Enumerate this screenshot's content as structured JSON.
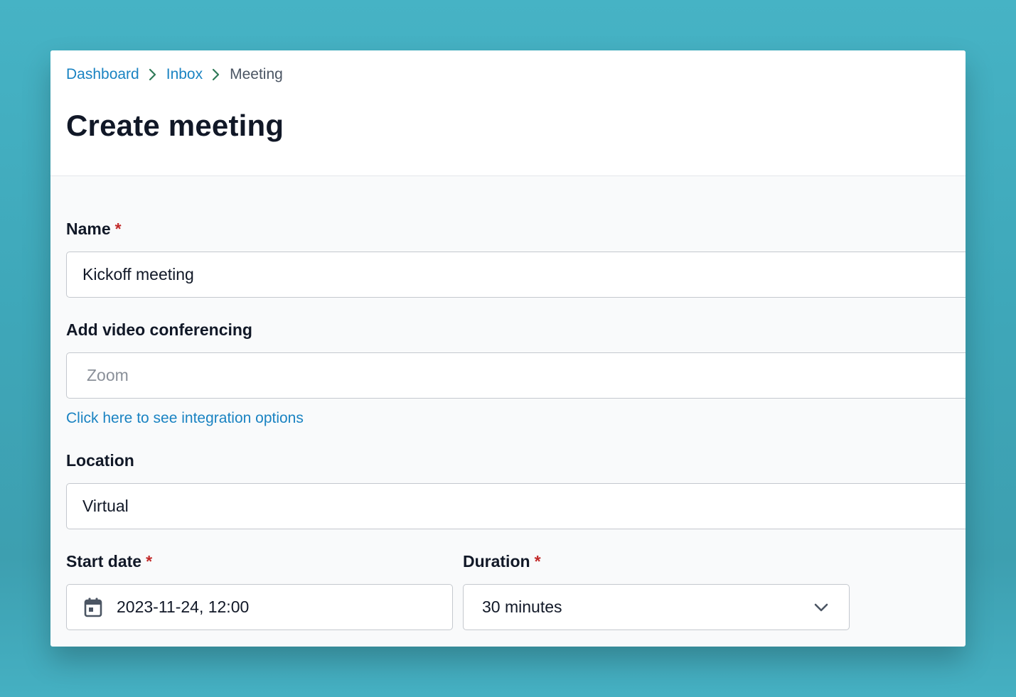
{
  "breadcrumb": {
    "items": [
      {
        "label": "Dashboard"
      },
      {
        "label": "Inbox"
      },
      {
        "label": "Meeting"
      }
    ]
  },
  "page": {
    "title": "Create meeting"
  },
  "form": {
    "required_marker": "*",
    "name": {
      "label": "Name",
      "value": "Kickoff meeting"
    },
    "video": {
      "label": "Add video conferencing",
      "placeholder": "Zoom",
      "link": "Click here to see integration options"
    },
    "location": {
      "label": "Location",
      "value": "Virtual"
    },
    "start_date": {
      "label": "Start date",
      "value": "2023-11-24, 12:00"
    },
    "duration": {
      "label": "Duration",
      "value": "30 minutes"
    }
  },
  "colors": {
    "accent_link": "#1a83c2",
    "required": "#c22a2a",
    "breadcrumb_separator": "#2f7a58",
    "background": "#46b3c5"
  },
  "icons": {
    "breadcrumb_separator": "chevron-right-icon",
    "start_date": "calendar-icon",
    "duration": "chevron-down-icon"
  }
}
